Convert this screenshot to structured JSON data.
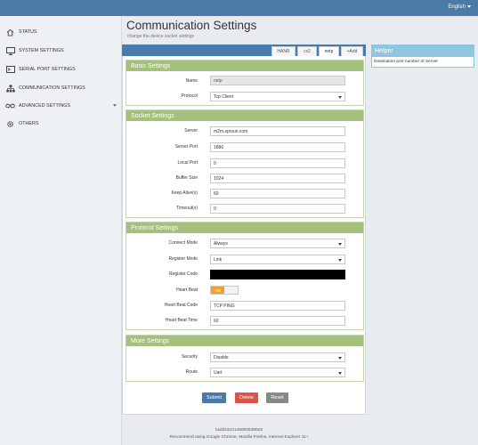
{
  "topbar": {
    "language": "English"
  },
  "sidebar": {
    "items": [
      {
        "label": "STATUS",
        "icon": "home-icon"
      },
      {
        "label": "SYSTEM SETTINGS",
        "icon": "monitor-icon"
      },
      {
        "label": "SERIAL PORT SETTINGS",
        "icon": "terminal-icon"
      },
      {
        "label": "COMMUNICATION SETTINGS",
        "icon": "network-icon"
      },
      {
        "label": "ADVANCED SETTINGS",
        "icon": "infinity-icon"
      },
      {
        "label": "OTHERS",
        "icon": "gear-icon"
      }
    ]
  },
  "page": {
    "title": "Communication Settings",
    "subtitle": "change the device socket settings"
  },
  "tabs": [
    {
      "label": "HANR"
    },
    {
      "label": "cs2"
    },
    {
      "label": "netp"
    },
    {
      "label": "+Add"
    }
  ],
  "basic": {
    "heading": "Basic Settings",
    "name_label": "Name",
    "name_value": "netp",
    "protocol_label": "Protocol",
    "protocol_value": "Tcp Client"
  },
  "socket": {
    "heading": "Socket Settings",
    "server_label": "Server",
    "server_value": "m2m.sprsun.com",
    "server_port_label": "Server Port",
    "server_port_value": "1886",
    "local_port_label": "Local Port",
    "local_port_value": "0",
    "buffer_label": "Buffer Size",
    "buffer_value": "1024",
    "keepalive_label": "Keep Alive",
    "keepalive_unit": "(s)",
    "keepalive_value": "60",
    "timeout_label": "Timeout",
    "timeout_unit": "(s)",
    "timeout_value": "0"
  },
  "protocol": {
    "heading": "Protocol Settings",
    "connect_label": "Connect Mode",
    "connect_value": "Always",
    "register_label": "Register Mode",
    "register_value": "Link",
    "regcode_label": "Register Code",
    "heartbeat_label": "Heart Beat",
    "heartbeat_state": "ON",
    "hbcode_label": "Heart Beat Code",
    "hbcode_value": "TCP PING",
    "hbtime_label": "Heart Beat Time",
    "hbtime_value": "60"
  },
  "more": {
    "heading": "More Settings",
    "security_label": "Security",
    "security_value": "Disable",
    "route_label": "Route",
    "route_value": "Uart"
  },
  "actions": {
    "submit": "Submit",
    "delete": "Delete",
    "reset": "Reset"
  },
  "helper": {
    "heading": "Helper",
    "text": "Destination port number of Server"
  },
  "footer": {
    "build": "build2310145000538029",
    "recommend": "Recommend using Google Chrome, Mozilla Firefox, Internet Explorer 11+"
  },
  "colors": {
    "topbar": "#4a7aa8",
    "section_header": "#a3c07c",
    "helper_header": "#8fc6df",
    "submit": "#4a7aa8",
    "delete": "#d9534f",
    "reset": "#888888",
    "toggle_on": "#f0a030"
  }
}
